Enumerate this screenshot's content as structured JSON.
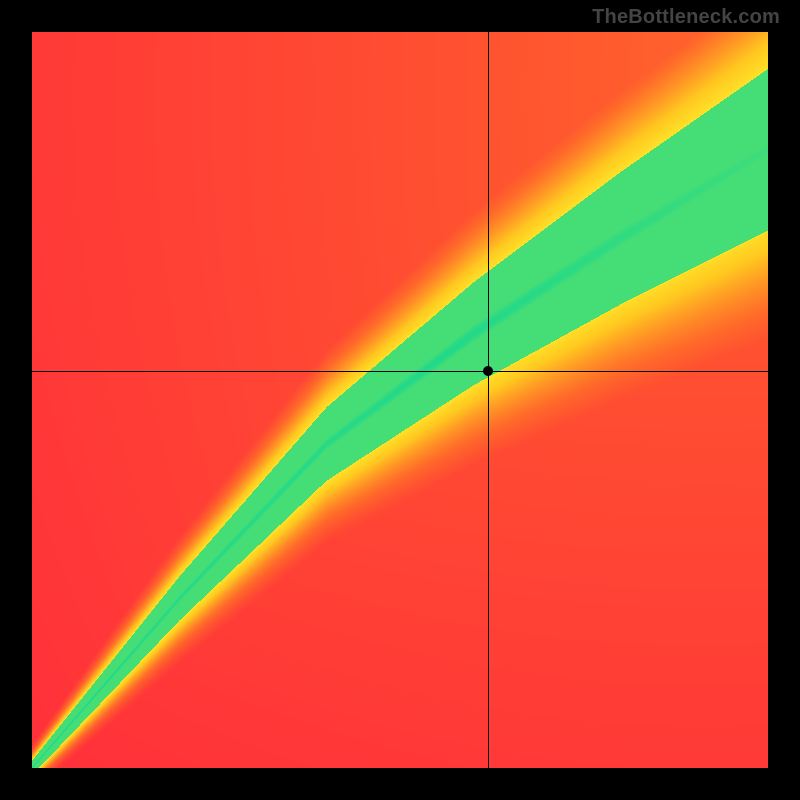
{
  "watermark": "TheBottleneck.com",
  "chart_data": {
    "type": "heatmap",
    "title": "",
    "xlabel": "",
    "ylabel": "",
    "x_range": [
      0,
      100
    ],
    "y_range": [
      0,
      100
    ],
    "legend": false,
    "grid": false,
    "colormap_description": "red (mismatch) → orange → yellow → green (balanced)",
    "color_stops": [
      {
        "t": 0.0,
        "hex": "#ff1f3f"
      },
      {
        "t": 0.25,
        "hex": "#ff6a2a"
      },
      {
        "t": 0.5,
        "hex": "#ffc820"
      },
      {
        "t": 0.72,
        "hex": "#fff12e"
      },
      {
        "t": 0.9,
        "hex": "#9fe84a"
      },
      {
        "t": 1.0,
        "hex": "#1fd98a"
      }
    ],
    "green_band_center_points": [
      {
        "x": 0,
        "y": 0
      },
      {
        "x": 20,
        "y": 23
      },
      {
        "x": 40,
        "y": 44
      },
      {
        "x": 60,
        "y": 59
      },
      {
        "x": 80,
        "y": 72
      },
      {
        "x": 100,
        "y": 84
      }
    ],
    "green_band_halfwidth_points": [
      {
        "x": 0,
        "w": 1
      },
      {
        "x": 20,
        "w": 3
      },
      {
        "x": 40,
        "w": 5
      },
      {
        "x": 60,
        "w": 7
      },
      {
        "x": 80,
        "w": 9
      },
      {
        "x": 100,
        "w": 11
      }
    ],
    "crosshair": {
      "x": 62,
      "y": 54
    },
    "marker": {
      "x": 62,
      "y": 54
    },
    "origin": "bottom-left"
  }
}
